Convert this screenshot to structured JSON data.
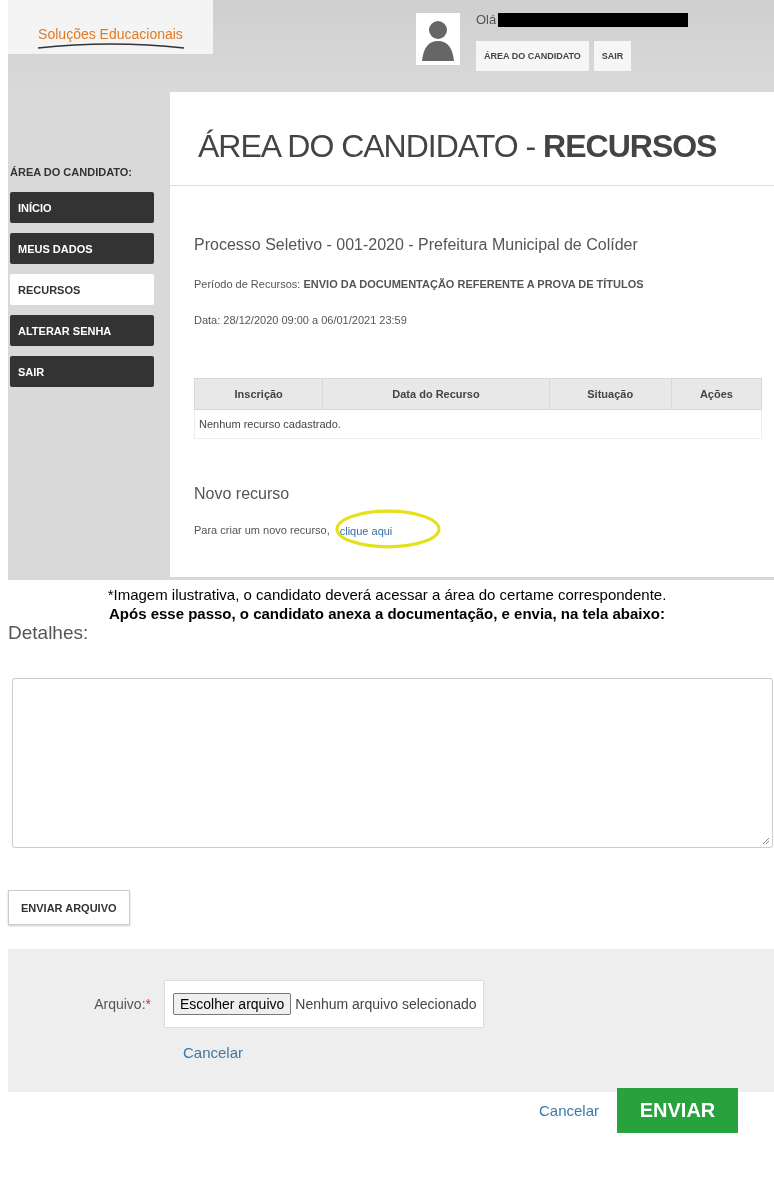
{
  "screenshot_1": {
    "header": {
      "logo_subtitle": "Soluções Educacionais",
      "greeting": "Olá",
      "buttons": [
        "ÁREA DO CANDIDATO",
        "SAIR"
      ]
    },
    "sidebar": {
      "label": "ÁREA DO CANDIDATO:",
      "items": [
        {
          "label": "INÍCIO",
          "selected": false
        },
        {
          "label": "MEUS DADOS",
          "selected": false
        },
        {
          "label": "RECURSOS",
          "selected": true
        },
        {
          "label": "ALTERAR SENHA",
          "selected": false
        },
        {
          "label": "SAIR",
          "selected": false
        }
      ]
    },
    "title": {
      "light": "ÁREA DO CANDIDATO -",
      "bold": "RECURSOS"
    },
    "process": "Processo Seletivo - 001-2020 - Prefeitura Municipal de Colíder",
    "period": "Período de Recursos: **ENVIO DA DOCUMENTAÇÃO REFERENTE A PROVA DE TÍTULOS**",
    "date": "Data: 28/12/2020 09:00 a 06/01/2021 23:59",
    "table": {
      "columns": [
        "Inscrição",
        "Data do Recurso",
        "Situação",
        "Ações"
      ],
      "empty_message": "Nenhum recurso cadastrado."
    },
    "new_heading": "Novo recurso",
    "new_text": "Para criar um novo recurso,",
    "new_link": "clique aqui"
  },
  "caption": "*Imagem ilustrativa, o candidato deverá acessar a área do certame correspondente.",
  "instruction": "Após esse passo, o candidato anexa a documentação, e envia, na tela abaixo:",
  "screenshot_2": {
    "details_label": "Detalhes:",
    "upload_button": "ENVIAR ARQUIVO",
    "file_label": "Arquivo:",
    "required_mark": "*",
    "file_button": "Escolher arquivo",
    "file_status": "Nenhum arquivo selecionado",
    "panel_cancel": "Cancelar",
    "footer_cancel": "Cancelar",
    "submit": "ENVIAR"
  }
}
